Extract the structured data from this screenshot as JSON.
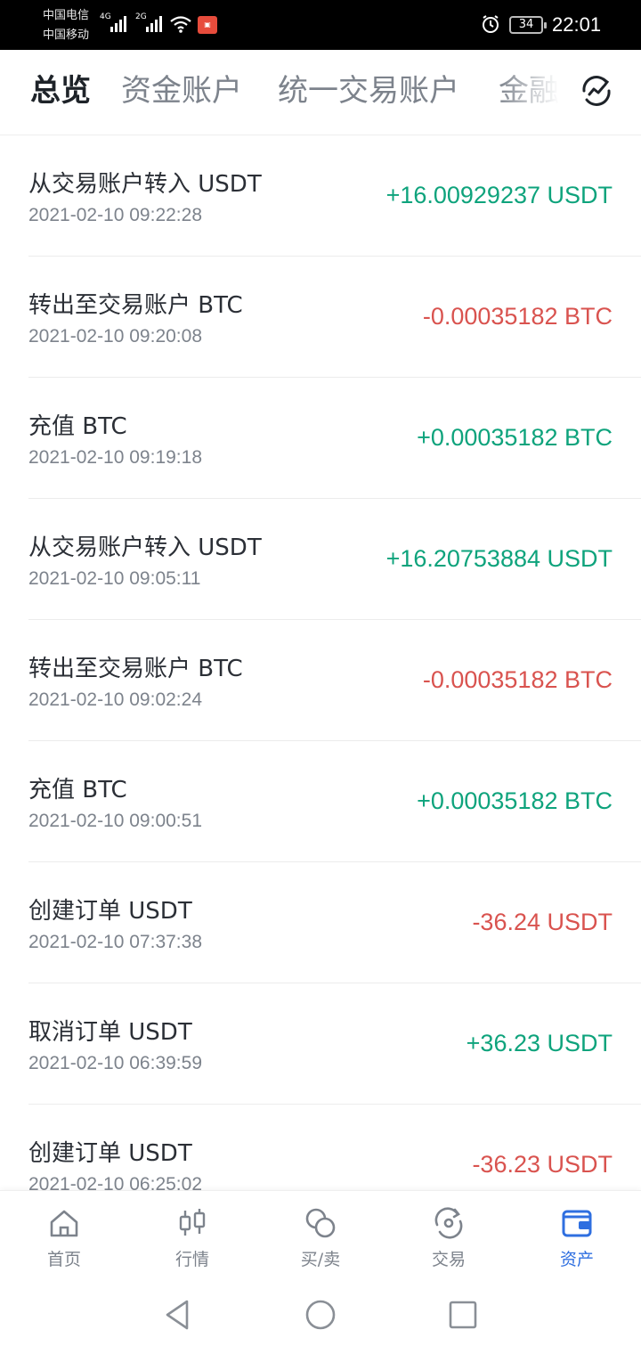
{
  "status_bar": {
    "carrier_1": "中国电信",
    "carrier_2": "中国移动",
    "net_1": "4G",
    "net_2": "2G",
    "battery": "34",
    "time": "22:01"
  },
  "tabs": [
    {
      "label": "总览",
      "active": true
    },
    {
      "label": "资金账户",
      "active": false
    },
    {
      "label": "统一交易账户",
      "active": false
    },
    {
      "label": "金融",
      "active": false
    }
  ],
  "records": [
    {
      "title": "从交易账户转入 USDT",
      "time": "2021-02-10 09:22:28",
      "amount": "+16.00929237 USDT",
      "direction": "in"
    },
    {
      "title": "转出至交易账户 BTC",
      "time": "2021-02-10 09:20:08",
      "amount": "-0.00035182 BTC",
      "direction": "out"
    },
    {
      "title": "充值 BTC",
      "time": "2021-02-10 09:19:18",
      "amount": "+0.00035182 BTC",
      "direction": "in"
    },
    {
      "title": "从交易账户转入 USDT",
      "time": "2021-02-10 09:05:11",
      "amount": "+16.20753884 USDT",
      "direction": "in"
    },
    {
      "title": "转出至交易账户 BTC",
      "time": "2021-02-10 09:02:24",
      "amount": "-0.00035182 BTC",
      "direction": "out"
    },
    {
      "title": "充值 BTC",
      "time": "2021-02-10 09:00:51",
      "amount": "+0.00035182 BTC",
      "direction": "in"
    },
    {
      "title": "创建订单 USDT",
      "time": "2021-02-10 07:37:38",
      "amount": "-36.24 USDT",
      "direction": "out"
    },
    {
      "title": "取消订单 USDT",
      "time": "2021-02-10 06:39:59",
      "amount": "+36.23 USDT",
      "direction": "in"
    },
    {
      "title": "创建订单 USDT",
      "time": "2021-02-10 06:25:02",
      "amount": "-36.23 USDT",
      "direction": "out"
    }
  ],
  "bottom_nav": [
    {
      "label": "首页",
      "icon": "home-icon",
      "active": false
    },
    {
      "label": "行情",
      "icon": "candlestick-icon",
      "active": false
    },
    {
      "label": "买/卖",
      "icon": "coins-icon",
      "active": false
    },
    {
      "label": "交易",
      "icon": "exchange-icon",
      "active": false
    },
    {
      "label": "资产",
      "icon": "wallet-icon",
      "active": true
    }
  ],
  "colors": {
    "positive": "#0ea37c",
    "negative": "#d9534f",
    "accent": "#2f6fe0"
  }
}
